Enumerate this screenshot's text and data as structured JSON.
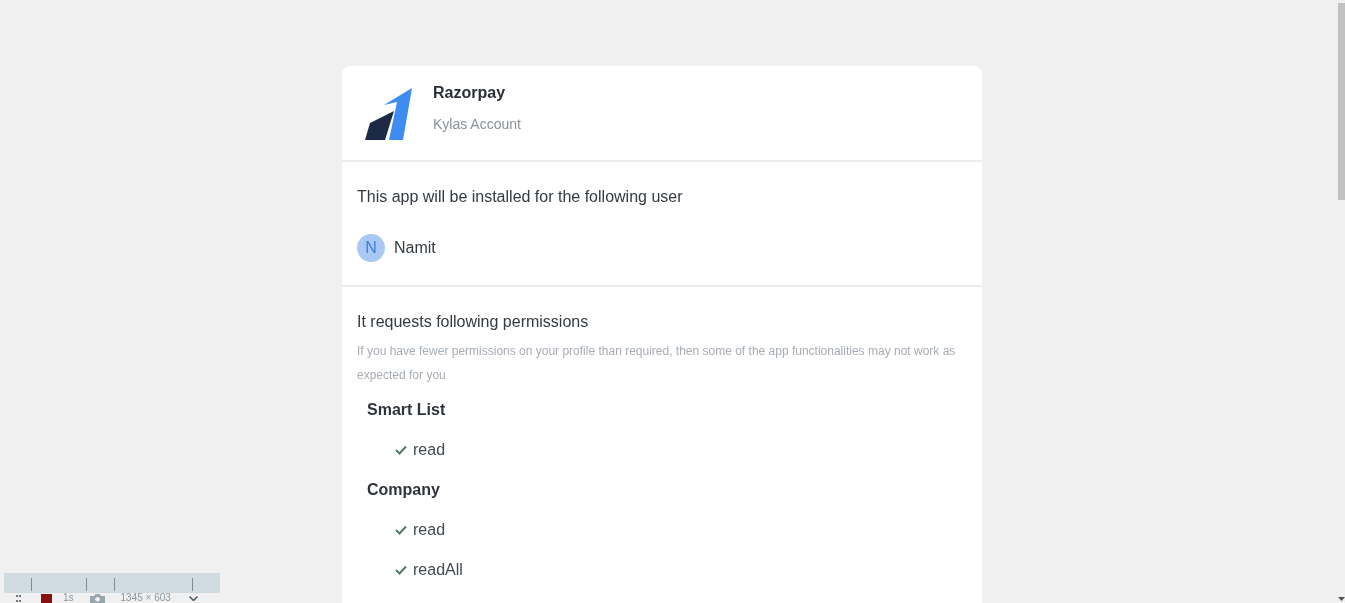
{
  "app": {
    "name": "Razorpay",
    "account": "Kylas Account"
  },
  "install": {
    "message": "This app will be installed for the following user",
    "user": {
      "initial": "N",
      "name": "Namit"
    }
  },
  "permissions": {
    "heading": "It requests following permissions",
    "note": "If you have fewer permissions on your profile than required, then some of the app functionalities may not work as expected for you",
    "groups": [
      {
        "name": "Smart List",
        "items": [
          {
            "label": "read",
            "checked": true
          }
        ]
      },
      {
        "name": "Company",
        "items": [
          {
            "label": "read",
            "checked": true
          },
          {
            "label": "readAll",
            "checked": true
          }
        ]
      }
    ]
  },
  "recorder_toolbar": {
    "duration": "1s",
    "size": "1345 × 603"
  }
}
